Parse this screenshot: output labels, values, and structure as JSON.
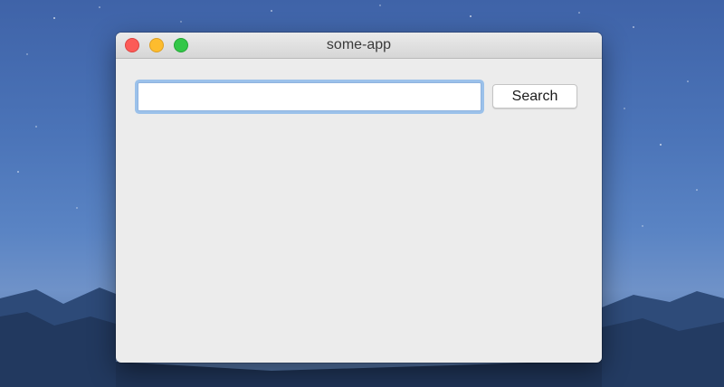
{
  "window": {
    "title": "some-app",
    "controls": [
      "close-icon",
      "minimize-icon",
      "zoom-icon"
    ]
  },
  "search": {
    "value": "",
    "placeholder": "",
    "button_label": "Search"
  },
  "colors": {
    "close": "#fc5b57",
    "minimize": "#fdbc2e",
    "zoom": "#33c748",
    "focus_ring": "#9bc1ea",
    "window_bg": "#ececec"
  }
}
